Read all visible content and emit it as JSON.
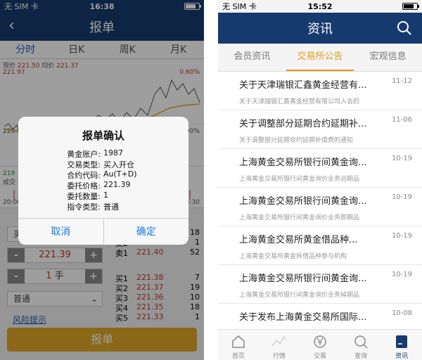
{
  "left": {
    "status": {
      "carrier": "无 SIM 卡",
      "time": "16:38"
    },
    "title": "报单",
    "chart_tabs": [
      "分时",
      "日K",
      "周K",
      "月K"
    ],
    "chart": {
      "current_price_label": "现价",
      "current_price": "221.50",
      "avg_price_label": "均价",
      "avg_price": "221.37",
      "top_value": "221.97",
      "top_pct": "0.60%",
      "zero_pct": "0.00%",
      "mid_value": "220.65",
      "time_start": "20:00",
      "time_end": "15:30",
      "vol_value": "219",
      "vol_label": "成交"
    },
    "form": {
      "order_type": "买入开仓",
      "price": "221.39",
      "quantity": "1",
      "unit": "手",
      "mode": "普通",
      "risk_link": "风险提示",
      "submit": "报单",
      "minus": "-",
      "plus": "+"
    },
    "order_book": [
      {
        "name": "卖3",
        "price": "221.45",
        "qty": "18"
      },
      {
        "name": "卖2",
        "price": "221.44",
        "qty": "1"
      },
      {
        "name": "卖1",
        "price": "221.40",
        "qty": "52"
      },
      {
        "name": "买1",
        "price": "221.38",
        "qty": "7"
      },
      {
        "name": "买2",
        "price": "221.37",
        "qty": "19"
      },
      {
        "name": "买3",
        "price": "221.36",
        "qty": "10"
      },
      {
        "name": "买4",
        "price": "221.35",
        "qty": "18"
      },
      {
        "name": "买5",
        "price": "221.33",
        "qty": "1"
      }
    ],
    "dialog": {
      "title": "报单确认",
      "rows": [
        {
          "k": "黄金账户:",
          "v": "1987"
        },
        {
          "k": "交易类型:",
          "v": "买入开仓"
        },
        {
          "k": "合约代码:",
          "v": "Au(T+D)"
        },
        {
          "k": "委托价格:",
          "v": "221.39"
        },
        {
          "k": "委托数量:",
          "v": "1"
        },
        {
          "k": "指令类型:",
          "v": "普通"
        }
      ],
      "cancel": "取消",
      "confirm": "确定"
    }
  },
  "right": {
    "status": {
      "carrier": "无 SIM 卡",
      "time": "15:52"
    },
    "title": "资讯",
    "tabs": [
      "会员资讯",
      "交易所公告",
      "宏观信息"
    ],
    "items": [
      {
        "title": "关于天津瑞银汇鑫黄金经营有...",
        "summary": "关于天津瑞银汇鑫黄金经营有限公司入会的",
        "date": "11-12"
      },
      {
        "title": "关于调整部分延期合约延期补...",
        "summary": "关于调整部分延期合约延期补偿费的通知",
        "date": "11-06"
      },
      {
        "title": "上海黄金交易所银行间黄金询...",
        "summary": "上海黄金交易所银行间黄金询价业务远期品",
        "date": "10-19"
      },
      {
        "title": "上海黄金交易所银行间黄金询...",
        "summary": "上海黄金交易所银行间黄金询价业务即期品",
        "date": "10-19"
      },
      {
        "title": "上海黄金交易所黄金借品种...",
        "summary": "上海黄金交易所黄金拆借品种参与机构",
        "date": "10-19"
      },
      {
        "title": "上海黄金交易所银行间黄金询...",
        "summary": "上海黄金交易所银行间黄金询价业务掉期品",
        "date": "10-19"
      },
      {
        "title": "关于发布上海黄金交易所国际...",
        "summary": "",
        "date": "10-08"
      }
    ],
    "bottom_tabs": [
      {
        "label": "首页",
        "icon": "home-icon"
      },
      {
        "label": "行情",
        "icon": "chart-icon"
      },
      {
        "label": "交易",
        "icon": "yen-icon"
      },
      {
        "label": "查询",
        "icon": "search-icon"
      },
      {
        "label": "资讯",
        "icon": "news-icon"
      }
    ]
  }
}
